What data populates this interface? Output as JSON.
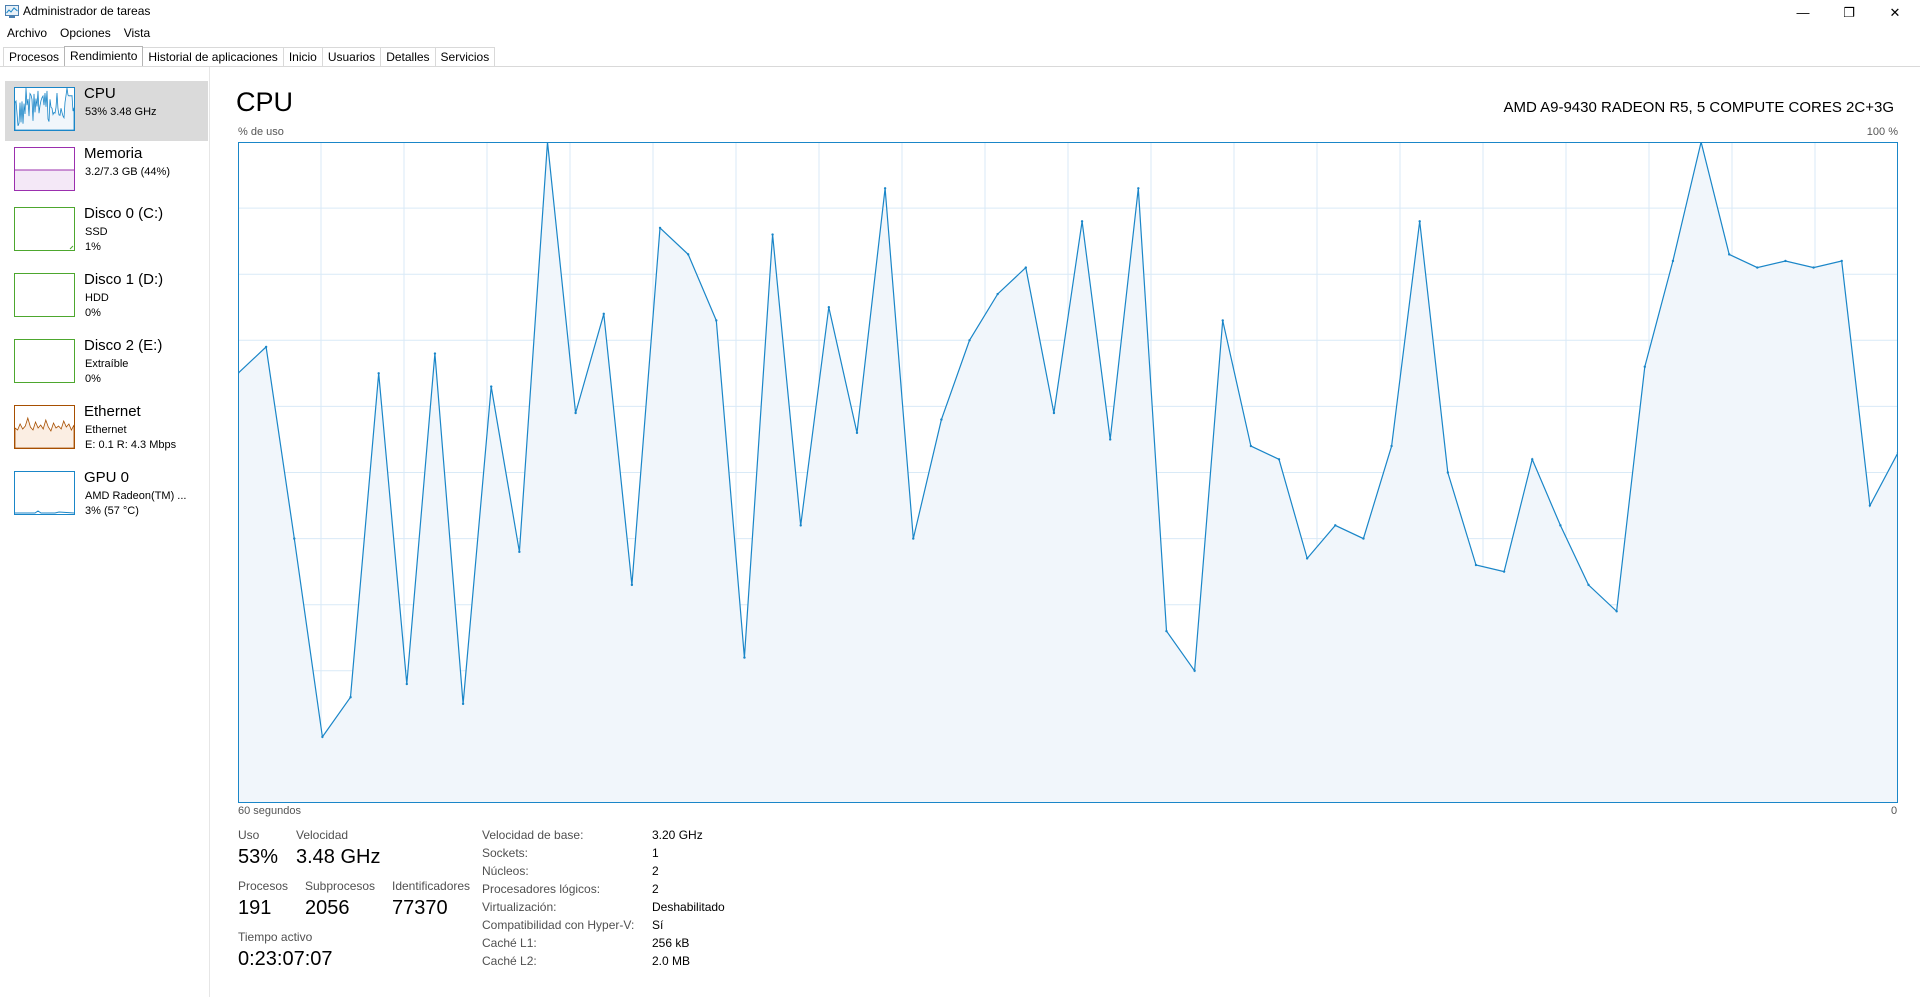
{
  "window": {
    "title": "Administrador de tareas",
    "controls": {
      "minimize": "—",
      "restore": "❐",
      "close": "✕"
    }
  },
  "menu": [
    "Archivo",
    "Opciones",
    "Vista"
  ],
  "tabs": [
    "Procesos",
    "Rendimiento",
    "Historial de aplicaciones",
    "Inicio",
    "Usuarios",
    "Detalles",
    "Servicios"
  ],
  "active_tab": "Rendimiento",
  "sidebar": [
    {
      "name": "CPU",
      "lines": [
        "53% 3.48 GHz"
      ],
      "color": "#1a86c8",
      "icon": "cpu-graph-icon"
    },
    {
      "name": "Memoria",
      "lines": [
        "3.2/7.3 GB (44%)"
      ],
      "color": "#9b2fae",
      "icon": "memory-graph-icon"
    },
    {
      "name": "Disco 0 (C:)",
      "lines": [
        "SSD",
        "1%"
      ],
      "color": "#4da72e",
      "icon": "disk-graph-icon"
    },
    {
      "name": "Disco 1 (D:)",
      "lines": [
        "HDD",
        "0%"
      ],
      "color": "#4da72e",
      "icon": "disk-graph-icon"
    },
    {
      "name": "Disco 2 (E:)",
      "lines": [
        "Extraíble",
        "0%"
      ],
      "color": "#4da72e",
      "icon": "disk-graph-icon"
    },
    {
      "name": "Ethernet",
      "lines": [
        "Ethernet",
        "E: 0.1  R: 4.3 Mbps"
      ],
      "color": "#a74f01",
      "icon": "ethernet-graph-icon"
    },
    {
      "name": "GPU 0",
      "lines": [
        "AMD Radeon(TM) ...",
        "3% (57 °C)"
      ],
      "color": "#1a86c8",
      "icon": "gpu-graph-icon"
    }
  ],
  "main": {
    "title": "CPU",
    "model": "AMD A9-9430 RADEON R5, 5 COMPUTE CORES 2C+3G",
    "y_label": "% de uso",
    "y_max_label": "100 %",
    "x_left_label": "60 segundos",
    "x_right_label": "0"
  },
  "chart_data": {
    "type": "area",
    "ylim": [
      0,
      100
    ],
    "xlim": [
      60,
      0
    ],
    "x_unit": "segundos",
    "line_color": "#1a86c8",
    "fill_color": "#f1f6fb",
    "grid": true,
    "x": [
      60,
      59,
      58,
      57,
      56,
      55,
      54,
      53,
      52,
      51,
      50,
      49,
      48,
      47,
      46,
      45,
      44,
      43,
      42,
      41,
      40,
      39,
      38,
      37,
      36,
      35,
      34,
      33,
      32,
      31,
      30,
      29,
      28,
      27,
      26,
      25,
      24,
      23,
      22,
      21,
      20,
      19,
      18,
      17,
      16,
      15,
      14,
      13,
      12,
      11,
      10,
      9,
      8,
      7,
      6,
      5,
      4,
      3,
      2,
      1,
      0
    ],
    "values": [
      65,
      69,
      40,
      10,
      16,
      65,
      18,
      68,
      15,
      63,
      38,
      100,
      59,
      74,
      33,
      87,
      83,
      73,
      22,
      86,
      42,
      75,
      56,
      93,
      40,
      58,
      70,
      77,
      81,
      59,
      88,
      55,
      93,
      26,
      20,
      73,
      54,
      52,
      37,
      42,
      40,
      54,
      88,
      50,
      36,
      35,
      52,
      42,
      33,
      29,
      66,
      82,
      100,
      83,
      81,
      82,
      81,
      82,
      45,
      53
    ],
    "kv_values_note": ""
  },
  "stats": {
    "uso": {
      "label": "Uso",
      "value": "53%"
    },
    "velocidad": {
      "label": "Velocidad",
      "value": "3.48 GHz"
    },
    "procesos": {
      "label": "Procesos",
      "value": "191"
    },
    "subprocesos": {
      "label": "Subprocesos",
      "value": "2056"
    },
    "identificadores": {
      "label": "Identificadores",
      "value": "77370"
    },
    "tiempo": {
      "label": "Tiempo activo",
      "value": "0:23:07:07"
    }
  },
  "specs": [
    [
      "Velocidad de base:",
      "3.20 GHz"
    ],
    [
      "Sockets:",
      "1"
    ],
    [
      "Núcleos:",
      "2"
    ],
    [
      "Procesadores lógicos:",
      "2"
    ],
    [
      "Virtualización:",
      "Deshabilitado"
    ],
    [
      "Compatibilidad con Hyper-V:",
      "Sí"
    ],
    [
      "Caché L1:",
      "256 kB"
    ],
    [
      "Caché L2:",
      "2.0 MB"
    ]
  ]
}
